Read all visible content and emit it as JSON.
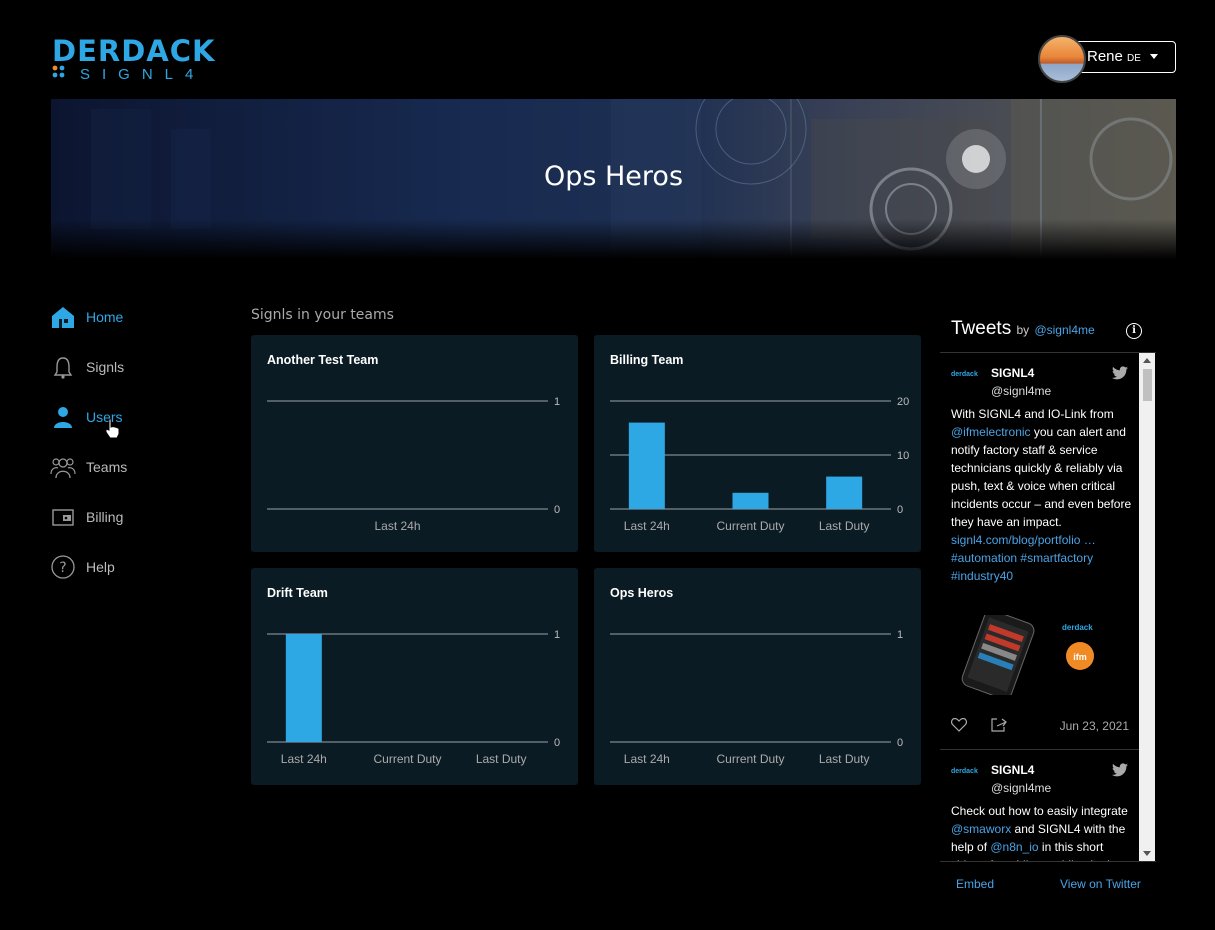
{
  "header": {
    "logo": {
      "brand": "DERDACK",
      "product": "SIGNL4"
    },
    "user": {
      "name": "Rene",
      "suffix": "DE"
    }
  },
  "banner": {
    "title": "Ops Heros"
  },
  "nav": {
    "items": [
      {
        "label": "Home",
        "icon": "home-icon",
        "active": true
      },
      {
        "label": "Signls",
        "icon": "bell-icon",
        "active": false
      },
      {
        "label": "Users",
        "icon": "user-icon",
        "active": false
      },
      {
        "label": "Teams",
        "icon": "team-icon",
        "active": false
      },
      {
        "label": "Billing",
        "icon": "wallet-icon",
        "active": false
      },
      {
        "label": "Help",
        "icon": "help-icon",
        "active": false
      }
    ]
  },
  "main": {
    "section_title": "Signls in your teams"
  },
  "cards": [
    {
      "title": "Another Test Team"
    },
    {
      "title": "Billing Team"
    },
    {
      "title": "Drift Team"
    },
    {
      "title": "Ops Heros"
    }
  ],
  "chart_data": [
    {
      "type": "bar",
      "title": "Another Test Team",
      "categories": [
        "Last 24h"
      ],
      "values": [
        0
      ],
      "ylim": [
        0,
        1
      ],
      "yticks": [
        0,
        1
      ]
    },
    {
      "type": "bar",
      "title": "Billing Team",
      "categories": [
        "Last 24h",
        "Current Duty",
        "Last Duty"
      ],
      "values": [
        16,
        3,
        6
      ],
      "ylim": [
        0,
        20
      ],
      "yticks": [
        0,
        10,
        20
      ]
    },
    {
      "type": "bar",
      "title": "Drift Team",
      "categories": [
        "Last 24h",
        "Current Duty",
        "Last Duty"
      ],
      "values": [
        1,
        0,
        0
      ],
      "ylim": [
        0,
        1
      ],
      "yticks": [
        0,
        1
      ]
    },
    {
      "type": "bar",
      "title": "Ops Heros",
      "categories": [
        "Last 24h",
        "Current Duty",
        "Last Duty"
      ],
      "values": [
        0,
        0,
        0
      ],
      "ylim": [
        0,
        1
      ],
      "yticks": [
        0,
        1
      ]
    }
  ],
  "tweets": {
    "title": "Tweets",
    "by": "by",
    "handle": "@signl4me",
    "items": [
      {
        "name": "SIGNL4",
        "handle": "@signl4me",
        "text_parts": [
          {
            "t": "With SIGNL4 and IO-Link from ",
            "link": false
          },
          {
            "t": "@ifmelectronic",
            "link": true
          },
          {
            "t": " you can alert and notify factory staff & service technicians quickly & reliably via push, text & voice when critical incidents occur – and even before they have an impact. ",
            "link": false
          },
          {
            "t": "signl4.com/blog/portfolio …",
            "link": true
          },
          {
            "t": "#automation",
            "link": true
          },
          {
            "t": " ",
            "link": false
          },
          {
            "t": "#smartfactory",
            "link": true
          },
          {
            "t": " ",
            "link": false
          },
          {
            "t": "#industry40",
            "link": true
          }
        ],
        "date": "Jun 23, 2021"
      },
      {
        "name": "SIGNL4",
        "handle": "@signl4me",
        "text_parts": [
          {
            "t": "Check out how to easily integrate ",
            "link": false
          },
          {
            "t": "@smaworx",
            "link": true
          },
          {
            "t": " and SIGNL4 with the help of ",
            "link": false
          },
          {
            "t": "@n8n_io",
            "link": true
          },
          {
            "t": " in this short video of enabling mobile alerting",
            "link": false
          }
        ],
        "date": ""
      }
    ],
    "embed_label": "Embed",
    "view_label": "View on Twitter"
  },
  "colors": {
    "accent": "#2ea8e5",
    "card_bg": "#0b1b24",
    "bar": "#2ea8e5"
  }
}
